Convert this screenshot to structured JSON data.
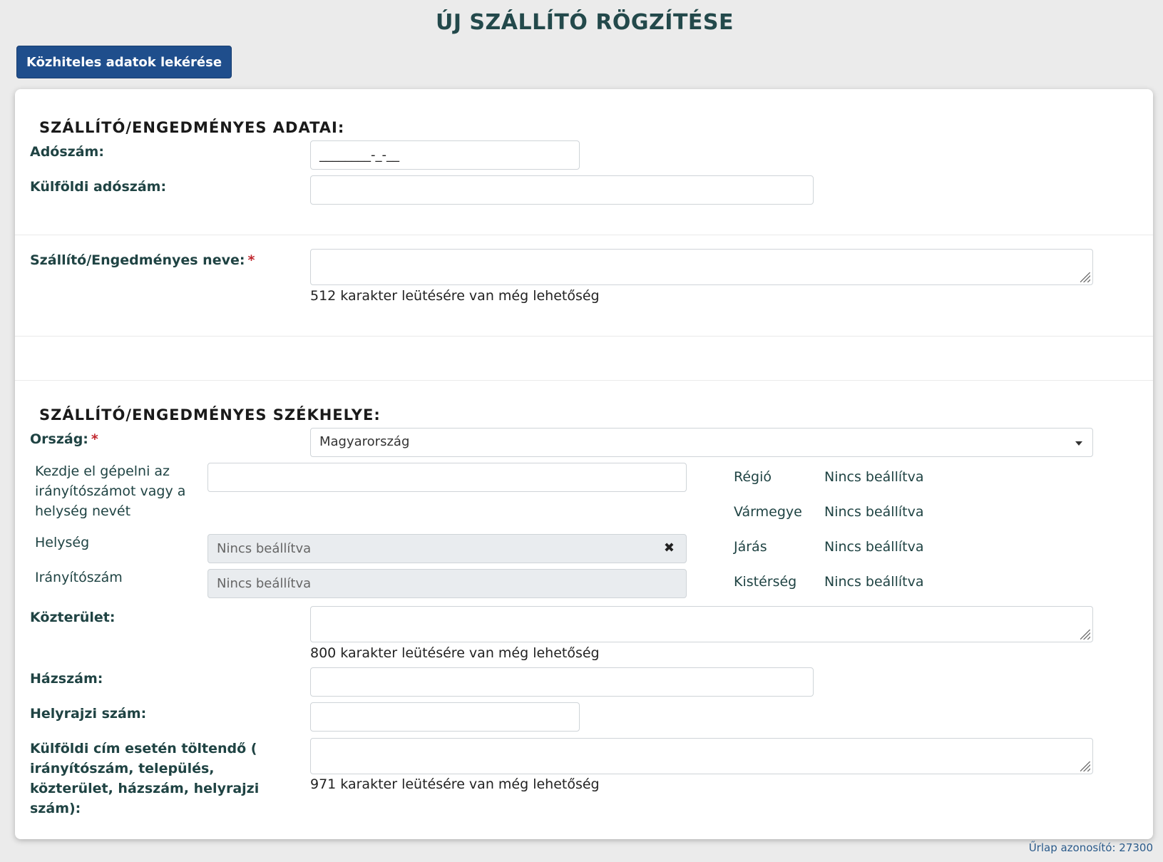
{
  "page": {
    "title": "ÚJ SZÁLLÍTÓ RÖGZÍTÉSE",
    "fetch_button": "Közhiteles adatok lekérése",
    "form_id": "Űrlap azonosító: 27300"
  },
  "section1": {
    "title": "SZÁLLÍTÓ/ENGEDMÉNYES ADATAI:",
    "tax_number_label": "Adószám:",
    "tax_number_mask": "________-_-__",
    "foreign_tax_label": "Külföldi adószám:",
    "name_label": "Szállító/Engedményes neve:",
    "required_mark": "*",
    "name_counter": "512 karakter leütésére van még lehetőség"
  },
  "section2": {
    "title": "SZÁLLÍTÓ/ENGEDMÉNYES SZÉKHELYE:",
    "country_label": "Ország:",
    "required_mark": "*",
    "country_value": "Magyarország",
    "search_label": "Kezdje el gépelni az irányítószámot vagy a helység nevét",
    "locality_label": "Helység",
    "locality_value": "Nincs beállítva",
    "zip_label": "Irányítószám",
    "zip_value": "Nincs beállítva",
    "info": [
      {
        "label": "Régió",
        "value": "Nincs beállítva"
      },
      {
        "label": "Vármegye",
        "value": "Nincs beállítva"
      },
      {
        "label": "Járás",
        "value": "Nincs beállítva"
      },
      {
        "label": "Kistérség",
        "value": "Nincs beállítva"
      }
    ],
    "street_label": "Közterület:",
    "street_counter": "800 karakter leütésére van még lehetőség",
    "house_label": "Házszám:",
    "lot_label": "Helyrajzi szám:",
    "foreign_addr_label": "Külföldi cím esetén töltendő ( irányítószám, település, közterület, házszám, helyrajzi szám):",
    "foreign_addr_counter": "971 karakter leütésére van még lehetőség"
  }
}
